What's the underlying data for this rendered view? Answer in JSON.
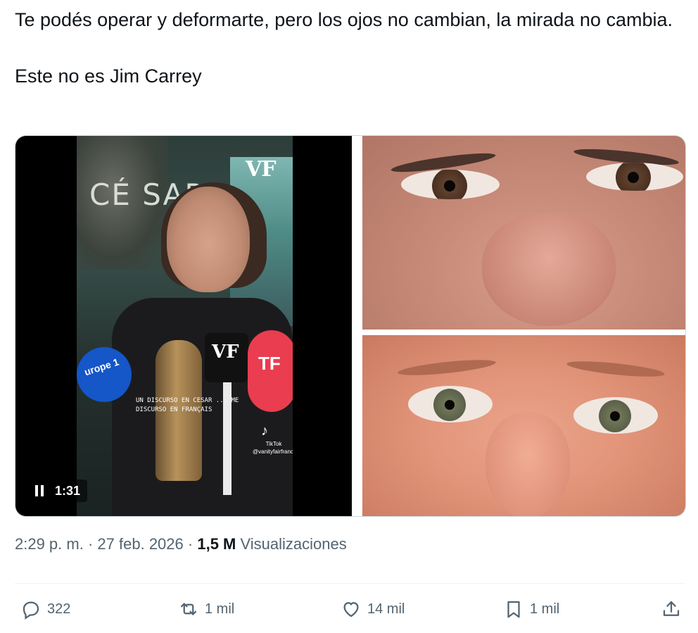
{
  "tweet": {
    "text_line1": "Te podés operar y deformarte, pero los ojos no cambian, la mirada no cambia.",
    "text_line2": "Este no es Jim Carrey"
  },
  "media": {
    "video": {
      "duration": "1:31",
      "state": "playing",
      "overlay_vf": "VF",
      "overlay_venue": "CÉ SAR",
      "overlay_caption": "UN DISCURSO EN CESAR ... ME DISCURSO EN FRANÇAIS",
      "mic_left_label": "urope 1",
      "mic_center_label": "VF",
      "mic_right_label": "TF",
      "tiktok_label": "TikTok",
      "tiktok_handle": "@vanityfairfrance"
    },
    "photo_top_alt": "close-up of eyes and nose",
    "photo_bottom_alt": "close-up of eyes"
  },
  "meta": {
    "time": "2:29 p. m.",
    "separator": "·",
    "date": "27 feb. 2026",
    "views_count": "1,5 M",
    "views_label": "Visualizaciones"
  },
  "actions": {
    "replies": "322",
    "retweets": "1 mil",
    "likes": "14 mil",
    "bookmarks": "1 mil"
  },
  "colors": {
    "text": "#0f1419",
    "secondary": "#536471",
    "border": "#cfd9de"
  }
}
